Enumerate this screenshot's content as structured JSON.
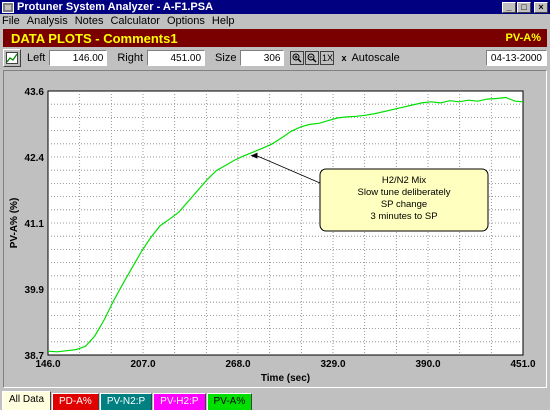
{
  "window": {
    "title": "Protuner System Analyzer - A-F1.PSA",
    "minimize": "_",
    "maximize": "□",
    "close": "×"
  },
  "menu": [
    {
      "label": "File"
    },
    {
      "label": "Analysis"
    },
    {
      "label": "Notes"
    },
    {
      "label": "Calculator"
    },
    {
      "label": "Options"
    },
    {
      "label": "Help"
    }
  ],
  "header": {
    "title": "DATA PLOTS - Comments1",
    "right": "PV-A%",
    "bg_color": "#7a0000",
    "text_color": "#ffff00"
  },
  "toolbar": {
    "left_label": "Left",
    "left_value": "146.00",
    "right_label": "Right",
    "right_value": "451.00",
    "size_label": "Size",
    "size_value": "306",
    "zoom_1x": "1X",
    "autoscale_label": "Autoscale",
    "autoscale_checked": "x",
    "date": "04-13-2000"
  },
  "chart_data": {
    "type": "line",
    "xlabel": "Time (sec)",
    "ylabel": "PV-A% (%)",
    "xlim": [
      146.0,
      451.0
    ],
    "ylim": [
      38.7,
      43.6
    ],
    "x_ticks": [
      "146.0",
      "207.0",
      "268.0",
      "329.0",
      "390.0",
      "451.0"
    ],
    "y_ticks": [
      "38.7",
      "39.9",
      "41.1",
      "42.4",
      "43.6"
    ],
    "grid": true,
    "series": [
      {
        "color": "#00e000",
        "x": [
          146,
          152,
          158,
          164,
          170,
          176,
          182,
          188,
          194,
          200,
          206,
          212,
          218,
          224,
          230,
          236,
          242,
          248,
          254,
          260,
          266,
          272,
          278,
          284,
          290,
          296,
          302,
          308,
          314,
          320,
          326,
          332,
          338,
          344,
          350,
          356,
          362,
          368,
          374,
          380,
          386,
          392,
          398,
          404,
          410,
          416,
          422,
          428,
          434,
          440,
          446,
          451
        ],
        "values": [
          38.77,
          38.76,
          38.78,
          38.8,
          38.86,
          39.05,
          39.35,
          39.7,
          40.02,
          40.32,
          40.62,
          40.88,
          41.1,
          41.22,
          41.35,
          41.55,
          41.75,
          41.95,
          42.12,
          42.22,
          42.32,
          42.4,
          42.47,
          42.54,
          42.62,
          42.73,
          42.85,
          42.93,
          42.98,
          43.0,
          43.05,
          43.1,
          43.12,
          43.13,
          43.15,
          43.18,
          43.22,
          43.26,
          43.3,
          43.34,
          43.38,
          43.4,
          43.38,
          43.42,
          43.4,
          43.43,
          43.41,
          43.45,
          43.46,
          43.48,
          43.41,
          43.4
        ]
      }
    ],
    "annotation": {
      "lines": [
        "H2/N2 Mix",
        "Slow tune deliberately",
        "SP change",
        "3 minutes to SP"
      ],
      "bg_color": "#ffffc0",
      "points_to": {
        "x": 276,
        "y": 42.4
      }
    }
  },
  "tabs": [
    {
      "label": "All Data",
      "color": "#000000",
      "bg": "#ffffe0"
    },
    {
      "label": "PD-A%",
      "color": "#ffffff",
      "bg": "#e00000"
    },
    {
      "label": "PV-N2:P",
      "color": "#ffffff",
      "bg": "#008080"
    },
    {
      "label": "PV-H2:P",
      "color": "#ffffff",
      "bg": "#ff00ff"
    },
    {
      "label": "PV-A%",
      "color": "#000000",
      "bg": "#00e000"
    }
  ]
}
